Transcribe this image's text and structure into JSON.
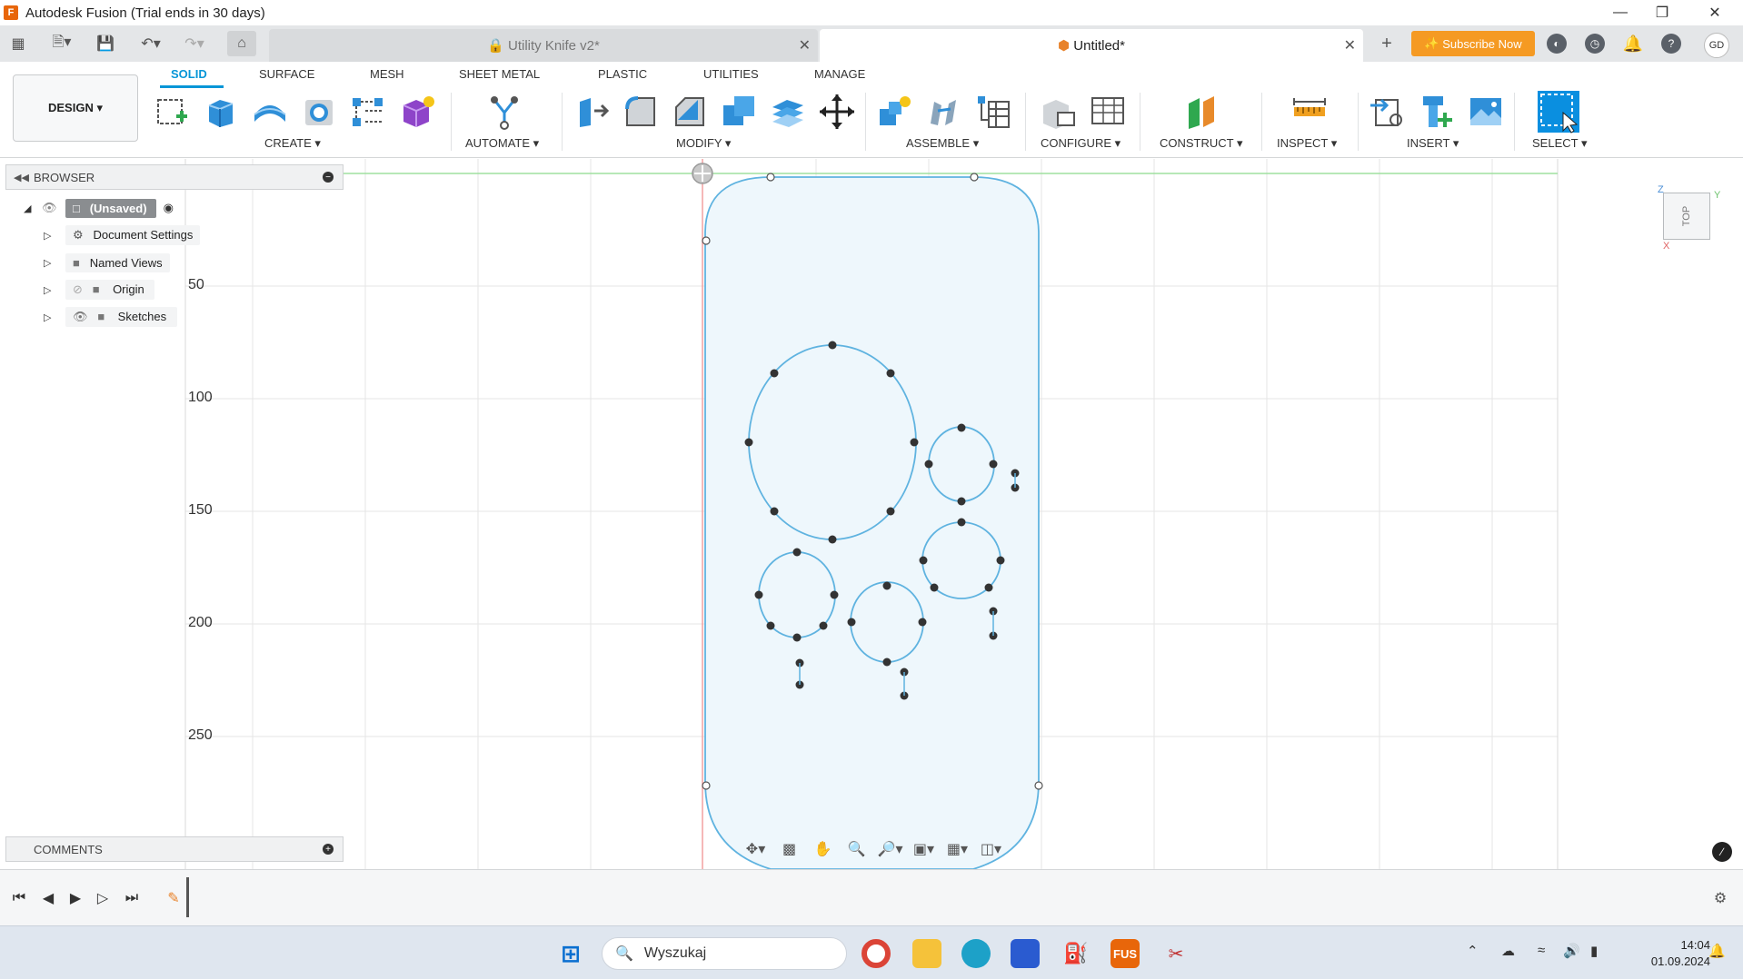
{
  "window": {
    "title": "Autodesk Fusion (Trial ends in 30 days)",
    "logo_letter": "F"
  },
  "tabs": [
    {
      "label": "Utility Knife v2*",
      "active": false
    },
    {
      "label": "Untitled*",
      "active": true
    }
  ],
  "header": {
    "subscribe_label": "Subscribe Now",
    "user_initials": "GD"
  },
  "workspace": {
    "design_label": "DESIGN ▾",
    "tabs": [
      "SOLID",
      "SURFACE",
      "MESH",
      "SHEET METAL",
      "PLASTIC",
      "UTILITIES",
      "MANAGE"
    ],
    "groups": [
      "CREATE ▾",
      "AUTOMATE ▾",
      "MODIFY ▾",
      "ASSEMBLE ▾",
      "CONFIGURE ▾",
      "CONSTRUCT ▾",
      "INSPECT ▾",
      "INSERT ▾",
      "SELECT ▾"
    ]
  },
  "browser": {
    "title": "BROWSER",
    "root": "(Unsaved)",
    "items": [
      "Document Settings",
      "Named Views",
      "Origin",
      "Sketches"
    ]
  },
  "comments": {
    "title": "COMMENTS"
  },
  "ruler": {
    "labels": [
      "50",
      "100",
      "150",
      "200",
      "250"
    ]
  },
  "viewcube": {
    "face": "TOP",
    "axis_z": "Z",
    "axis_y": "Y",
    "axis_x": "X"
  },
  "taskbar": {
    "search_placeholder": "Wyszukaj",
    "fusion_label": "FUS",
    "time": "14:04",
    "date": "01.09.2024"
  },
  "colors": {
    "accent": "#0696d7",
    "sketch_line": "#5fb3e0",
    "sketch_fill": "#eef7fc",
    "subscribe": "#f59a23",
    "grid": "#dcdcdc"
  }
}
